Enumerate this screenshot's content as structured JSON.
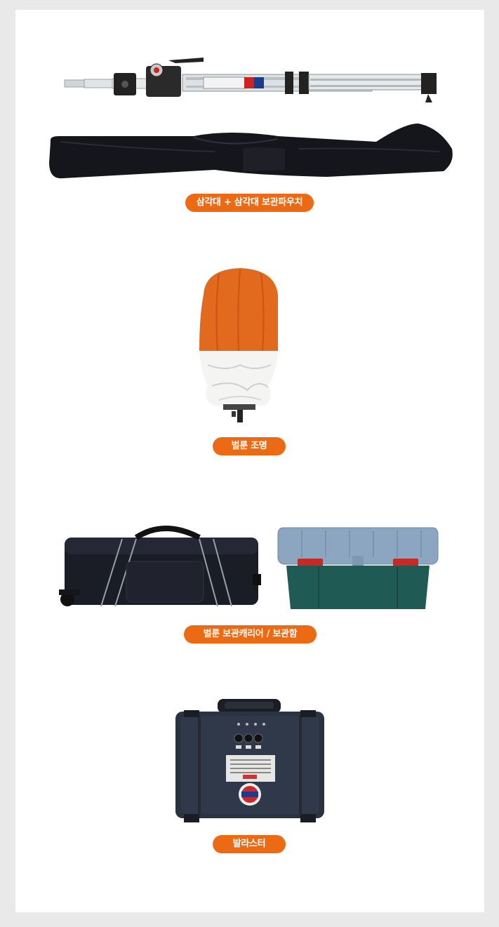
{
  "sections": [
    {
      "label": "삼각대 + 삼각대 보관파우치",
      "images": [
        "tripod",
        "tripod-storage-pouch"
      ]
    },
    {
      "label": "벌룬 조명",
      "images": [
        "balloon-light"
      ]
    },
    {
      "label": "벌룬 보관캐리어 / 보관함",
      "images": [
        "balloon-carrier-bag",
        "storage-box"
      ]
    },
    {
      "label": "발라스터",
      "images": [
        "ballast-case"
      ]
    }
  ],
  "colors": {
    "accent": "#ec6a13",
    "background": "#e9e9e9",
    "panel": "#ffffff"
  }
}
